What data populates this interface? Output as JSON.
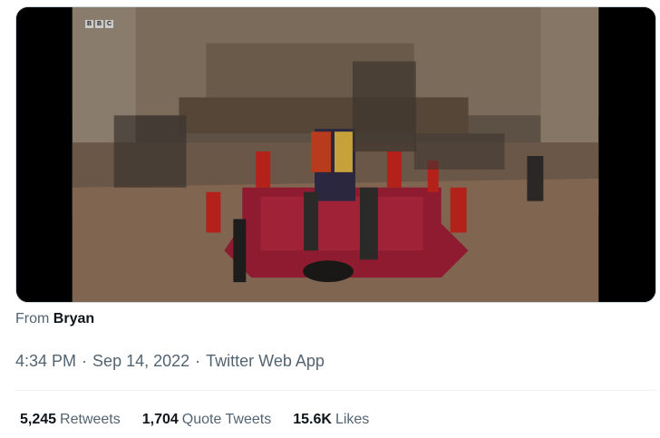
{
  "media": {
    "watermark_letters": [
      "B",
      "B",
      "C"
    ],
    "colors": {
      "carpet": "#8e1b2f",
      "floor": "#6b5747",
      "guard_red": "#b4201a"
    }
  },
  "tweet": {
    "from_prefix": "From",
    "from_name": "Bryan",
    "time": "4:34 PM",
    "separator": "·",
    "date": "Sep 14, 2022",
    "client": "Twitter Web App"
  },
  "stats": {
    "retweets": {
      "count": "5,245",
      "label": "Retweets"
    },
    "quotes": {
      "count": "1,704",
      "label": "Quote Tweets"
    },
    "likes": {
      "count": "15.6K",
      "label": "Likes"
    }
  }
}
